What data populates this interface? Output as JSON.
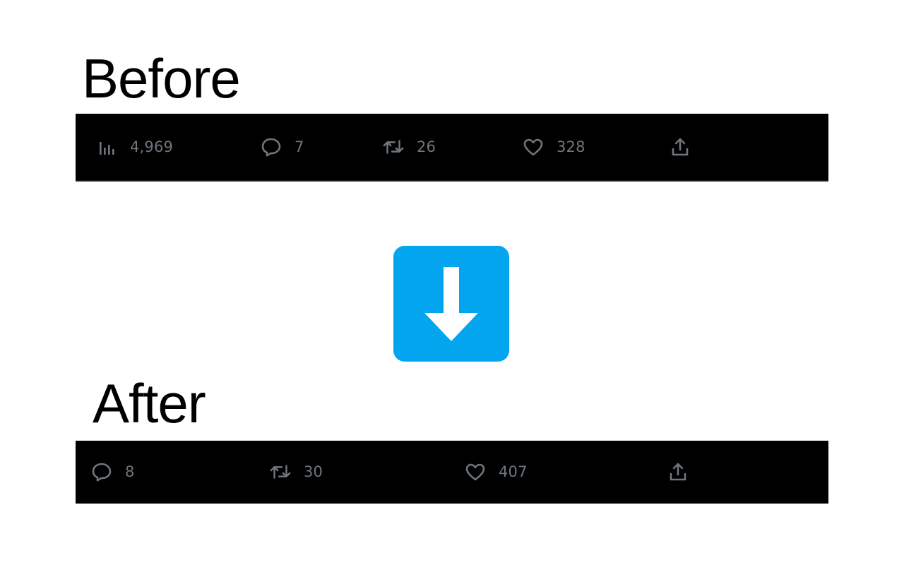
{
  "before": {
    "title": "Before",
    "actions": {
      "views": {
        "icon": "views-icon",
        "count": "4,969"
      },
      "reply": {
        "icon": "reply-icon",
        "count": "7"
      },
      "retweet": {
        "icon": "retweet-icon",
        "count": "26"
      },
      "like": {
        "icon": "heart-icon",
        "count": "328"
      },
      "share": {
        "icon": "share-icon"
      }
    }
  },
  "transition": {
    "icon": "arrow-down-icon",
    "color": "#03a5ef"
  },
  "after": {
    "title": "After",
    "actions": {
      "reply": {
        "icon": "reply-icon",
        "count": "8"
      },
      "retweet": {
        "icon": "retweet-icon",
        "count": "30"
      },
      "like": {
        "icon": "heart-icon",
        "count": "407"
      },
      "share": {
        "icon": "share-icon"
      }
    }
  },
  "colors": {
    "bar_background": "#000000",
    "icon_gray": "#6e767d"
  }
}
